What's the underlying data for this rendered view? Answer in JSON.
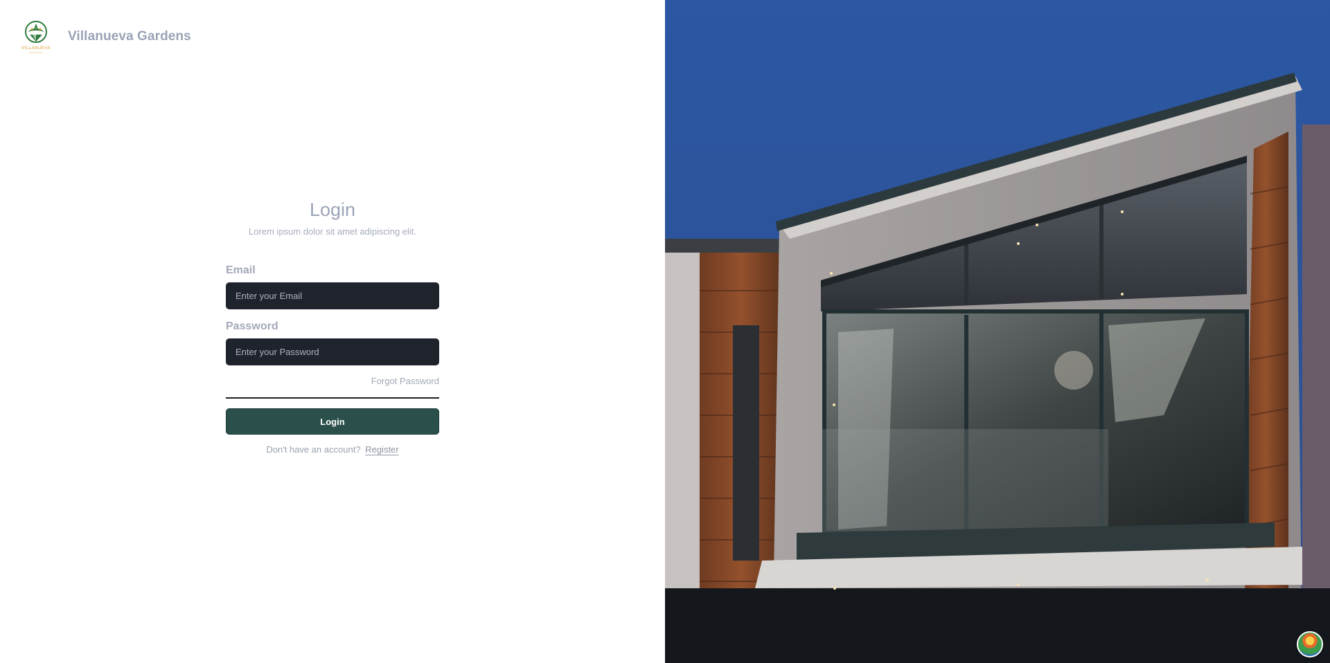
{
  "brand": {
    "name": "Villanueva Gardens",
    "logo_text": "VILLANUEVA"
  },
  "login": {
    "title": "Login",
    "subtitle": "Lorem ipsum dolor sit amet adipiscing elit.",
    "email_label": "Email",
    "email_placeholder": "Enter your Email",
    "password_label": "Password",
    "password_placeholder": "Enter your Password",
    "forgot_label": "Forgot Password",
    "submit_label": "Login",
    "register_prompt": "Don't have an account?",
    "register_label": "Register"
  },
  "hero": {
    "image": "modern-house-photo"
  },
  "colors": {
    "brand_text": "#9aa3b5",
    "input_bg": "#1f232b",
    "button_bg": "#2b504b",
    "sky": "#2e569f"
  },
  "icons": {
    "assistant": "assistant-avatar-icon"
  }
}
